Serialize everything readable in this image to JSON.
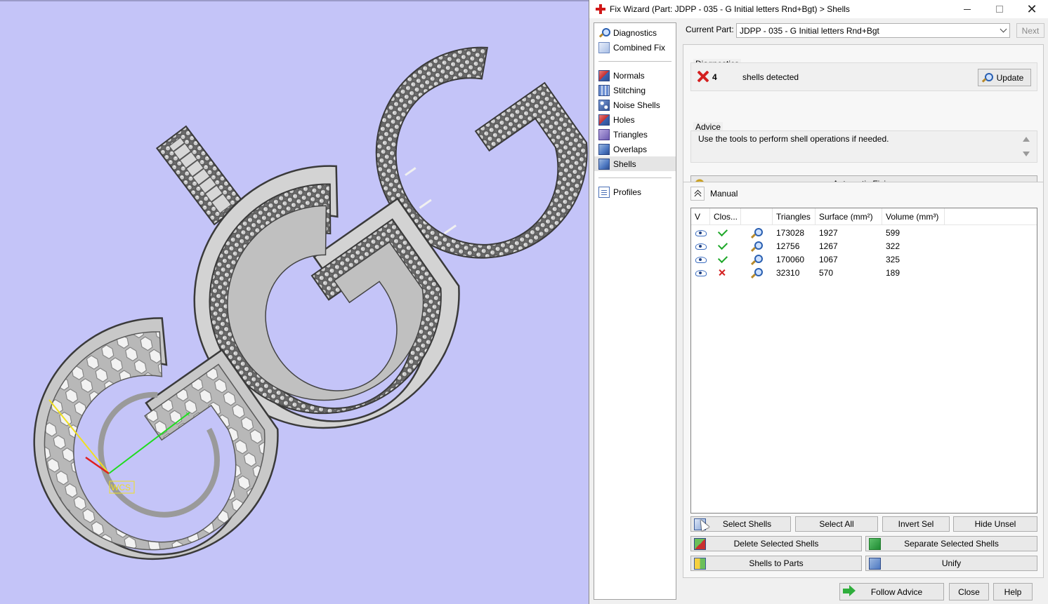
{
  "viewport": {
    "wcs_label": "WCS"
  },
  "window": {
    "title": "Fix Wizard (Part: JDPP - 035 - G Initial letters Rnd+Bgt) > Shells"
  },
  "sidebar": {
    "group1": [
      {
        "label": "Diagnostics",
        "icon": "magnifier-icon"
      },
      {
        "label": "Combined Fix",
        "icon": "combined-fix-icon"
      }
    ],
    "group2": [
      {
        "label": "Normals",
        "icon": "normals-icon"
      },
      {
        "label": "Stitching",
        "icon": "stitching-icon"
      },
      {
        "label": "Noise Shells",
        "icon": "noise-shells-icon"
      },
      {
        "label": "Holes",
        "icon": "holes-icon"
      },
      {
        "label": "Triangles",
        "icon": "triangles-icon"
      },
      {
        "label": "Overlaps",
        "icon": "overlaps-icon"
      },
      {
        "label": "Shells",
        "icon": "shells-icon",
        "selected": true
      }
    ],
    "group3": [
      {
        "label": "Profiles",
        "icon": "profiles-icon"
      }
    ]
  },
  "current_part": {
    "label": "Current Part:",
    "value": "JDPP - 035 - G Initial letters Rnd+Bgt",
    "next_label": "Next"
  },
  "diagnostics": {
    "legend": "Diagnostics",
    "count": "4",
    "status_text": "shells detected",
    "update_label": "Update"
  },
  "advice": {
    "legend": "Advice",
    "text": "Use the tools to perform shell operations if needed."
  },
  "automatic_fixing_label": "Automatic Fixing",
  "manual": {
    "legend": "Manual",
    "columns": [
      "V",
      "Clos...",
      "",
      "Triangles",
      "Surface (mm²)",
      "Volume (mm³)"
    ],
    "rows": [
      {
        "closed": true,
        "triangles": "173028",
        "surface": "1927",
        "volume": "599"
      },
      {
        "closed": true,
        "triangles": "12756",
        "surface": "1267",
        "volume": "322"
      },
      {
        "closed": true,
        "triangles": "170060",
        "surface": "1067",
        "volume": "325"
      },
      {
        "closed": false,
        "triangles": "32310",
        "surface": "570",
        "volume": "189"
      }
    ],
    "buttons": {
      "select_shells": "Select Shells",
      "select_all": "Select All",
      "invert_sel": "Invert Sel",
      "hide_unsel": "Hide Unsel",
      "delete_selected": "Delete Selected Shells",
      "separate_selected": "Separate Selected Shells",
      "shells_to_parts": "Shells to Parts",
      "unify": "Unify"
    }
  },
  "footer": {
    "follow_advice": "Follow Advice",
    "close": "Close",
    "help": "Help"
  },
  "colors": {
    "viewport_bg": "#c4c4f8",
    "check_green": "#1fa82a",
    "error_red": "#d42020"
  }
}
